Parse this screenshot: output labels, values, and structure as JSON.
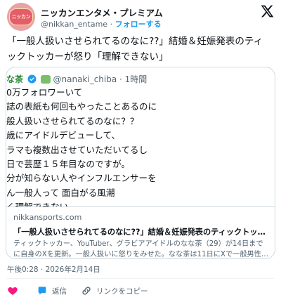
{
  "account": {
    "display_name": "ニッカンエンタメ・プレミアム",
    "handle": "@nikkan_entame",
    "separator": "·",
    "follow_label": "フォローする",
    "avatar_text": "ニッカン"
  },
  "tweet": {
    "text_lines": [
      "「一般人扱いさせられてるのなに??」結婚＆妊娠発表のティ",
      "ックトッカーが怒り「理解できない」"
    ]
  },
  "embedded_post": {
    "name_prefix": "な茶",
    "handle": "@nanaki_chiba",
    "time": "· 1時間",
    "body_lines": [
      "0万フォロワーいて",
      "誌の表紙も何回もやったことあるのに",
      "般人扱いさせられてるのなに？？",
      "歳にアイドルデビューして、",
      "ラマも複数出させていただいてるし",
      "日で芸歴１５年目なのですが。",
      "分が知らない人やインフルエンサーを",
      "ん一般人って 面白がる風潮",
      "く理解できない。"
    ]
  },
  "link_card": {
    "domain": "nikkansports.com",
    "title": "「一般人扱いさせられてるのなに??」結婚＆妊娠発表のティックトッカーが…",
    "description": "ティックトッカー、YouTuber、グラビアアイドルのなな茶（29）が14日までに自身のXを更新。一般人扱いに怒りをみせた。なな茶は11日にXで一般男性…"
  },
  "meta": {
    "timestamp": "午後0:28 · 2026年2月14日"
  },
  "actions": {
    "reply_label": "返信",
    "copy_link_label": "リンクをコピー"
  },
  "colors": {
    "accent": "#1d9bf0",
    "like": "#f91880",
    "text": "#0f1419",
    "secondary": "#536471"
  },
  "icons": [
    "x-logo-icon",
    "heart-icon",
    "reply-icon",
    "link-icon"
  ]
}
